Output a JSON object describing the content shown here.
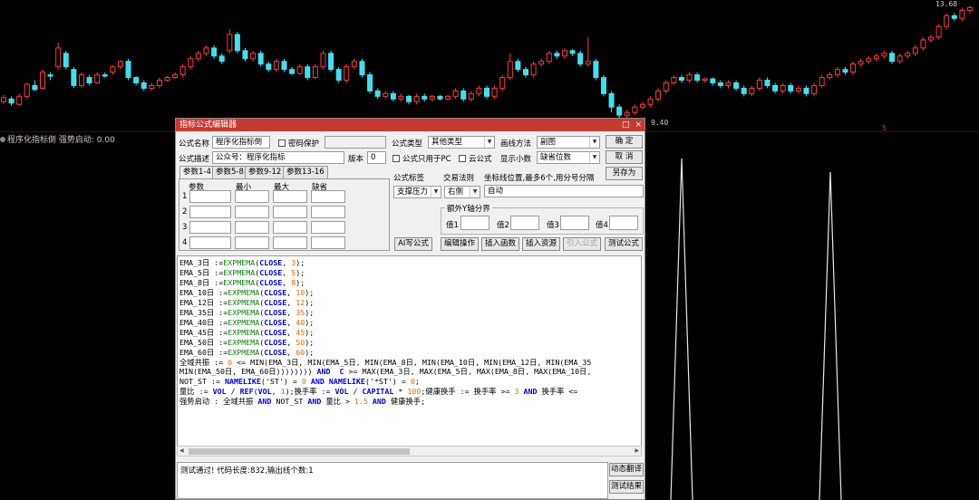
{
  "chart": {
    "price_high": "13.68",
    "price_low": "9.40",
    "candles": [
      {
        "o": 10.1,
        "c": 10.25,
        "h": 10.35,
        "l": 10.0
      },
      {
        "o": 10.2,
        "c": 10.05,
        "h": 10.3,
        "l": 9.95
      },
      {
        "o": 10.0,
        "c": 10.3,
        "h": 10.4,
        "l": 9.95
      },
      {
        "o": 10.3,
        "c": 10.75,
        "h": 10.8,
        "l": 10.2
      },
      {
        "o": 10.7,
        "c": 10.55,
        "h": 10.9,
        "l": 10.5
      },
      {
        "o": 10.6,
        "c": 11.2,
        "h": 11.3,
        "l": 10.55
      },
      {
        "o": 11.1,
        "c": 11.05,
        "h": 11.2,
        "l": 10.9
      },
      {
        "o": 11.4,
        "c": 12.1,
        "h": 12.3,
        "l": 11.3
      },
      {
        "o": 11.9,
        "c": 11.4,
        "h": 12.0,
        "l": 11.3
      },
      {
        "o": 11.3,
        "c": 10.7,
        "h": 11.4,
        "l": 10.6
      },
      {
        "o": 10.7,
        "c": 11.1,
        "h": 11.2,
        "l": 10.6
      },
      {
        "o": 11.0,
        "c": 10.8,
        "h": 11.1,
        "l": 10.7
      },
      {
        "o": 10.8,
        "c": 11.1,
        "h": 11.2,
        "l": 10.75
      },
      {
        "o": 11.1,
        "c": 11.05,
        "h": 11.2,
        "l": 11.0
      },
      {
        "o": 11.2,
        "c": 11.4,
        "h": 11.45,
        "l": 11.1
      },
      {
        "o": 11.4,
        "c": 11.6,
        "h": 11.65,
        "l": 11.3
      },
      {
        "o": 11.6,
        "c": 11.0,
        "h": 11.7,
        "l": 10.9
      },
      {
        "o": 11.0,
        "c": 10.8,
        "h": 11.05,
        "l": 10.7
      },
      {
        "o": 10.8,
        "c": 10.6,
        "h": 10.9,
        "l": 10.5
      },
      {
        "o": 10.6,
        "c": 10.7,
        "h": 10.8,
        "l": 10.5
      },
      {
        "o": 10.7,
        "c": 10.9,
        "h": 11.0,
        "l": 10.6
      },
      {
        "o": 10.9,
        "c": 11.0,
        "h": 11.05,
        "l": 10.85
      },
      {
        "o": 11.0,
        "c": 11.1,
        "h": 11.2,
        "l": 10.95
      },
      {
        "o": 11.1,
        "c": 11.4,
        "h": 11.5,
        "l": 11.0
      },
      {
        "o": 11.4,
        "c": 11.7,
        "h": 11.8,
        "l": 11.3
      },
      {
        "o": 11.7,
        "c": 11.9,
        "h": 12.0,
        "l": 11.6
      },
      {
        "o": 11.9,
        "c": 12.1,
        "h": 12.2,
        "l": 11.8
      },
      {
        "o": 12.1,
        "c": 11.8,
        "h": 12.2,
        "l": 11.7
      },
      {
        "o": 11.8,
        "c": 11.6,
        "h": 11.9,
        "l": 11.5
      },
      {
        "o": 12.0,
        "c": 12.6,
        "h": 12.8,
        "l": 11.9
      },
      {
        "o": 12.6,
        "c": 12.0,
        "h": 12.7,
        "l": 11.9
      },
      {
        "o": 12.0,
        "c": 11.7,
        "h": 12.1,
        "l": 11.6
      },
      {
        "o": 11.7,
        "c": 11.9,
        "h": 12.0,
        "l": 11.6
      },
      {
        "o": 11.9,
        "c": 11.5,
        "h": 12.0,
        "l": 11.4
      },
      {
        "o": 11.5,
        "c": 11.3,
        "h": 11.6,
        "l": 11.2
      },
      {
        "o": 11.3,
        "c": 11.6,
        "h": 11.7,
        "l": 11.2
      },
      {
        "o": 11.6,
        "c": 11.3,
        "h": 11.7,
        "l": 11.2
      },
      {
        "o": 11.3,
        "c": 11.15,
        "h": 11.4,
        "l": 11.1
      },
      {
        "o": 11.15,
        "c": 11.4,
        "h": 11.5,
        "l": 11.1
      },
      {
        "o": 11.4,
        "c": 11.0,
        "h": 11.5,
        "l": 10.9
      },
      {
        "o": 11.0,
        "c": 11.4,
        "h": 11.5,
        "l": 10.95
      },
      {
        "o": 11.4,
        "c": 11.9,
        "h": 12.0,
        "l": 11.3
      },
      {
        "o": 11.9,
        "c": 11.3,
        "h": 12.0,
        "l": 11.2
      },
      {
        "o": 11.3,
        "c": 10.9,
        "h": 11.4,
        "l": 10.8
      },
      {
        "o": 10.9,
        "c": 11.4,
        "h": 11.5,
        "l": 10.8
      },
      {
        "o": 11.4,
        "c": 11.6,
        "h": 11.7,
        "l": 11.3
      },
      {
        "o": 11.6,
        "c": 11.1,
        "h": 11.7,
        "l": 11.0
      },
      {
        "o": 11.1,
        "c": 10.5,
        "h": 11.2,
        "l": 10.4
      },
      {
        "o": 10.5,
        "c": 10.3,
        "h": 10.6,
        "l": 10.2
      },
      {
        "o": 10.3,
        "c": 10.4,
        "h": 10.5,
        "l": 10.2
      },
      {
        "o": 10.4,
        "c": 10.2,
        "h": 10.5,
        "l": 10.1
      },
      {
        "o": 10.2,
        "c": 10.3,
        "h": 10.4,
        "l": 10.1
      },
      {
        "o": 10.3,
        "c": 10.1,
        "h": 10.35,
        "l": 10.0
      },
      {
        "o": 10.1,
        "c": 10.3,
        "h": 10.4,
        "l": 10.0
      },
      {
        "o": 10.3,
        "c": 10.2,
        "h": 10.4,
        "l": 10.1
      },
      {
        "o": 10.2,
        "c": 10.3,
        "h": 10.35,
        "l": 10.1
      },
      {
        "o": 10.3,
        "c": 10.2,
        "h": 10.35,
        "l": 10.15
      },
      {
        "o": 10.2,
        "c": 10.3,
        "h": 10.35,
        "l": 10.15
      },
      {
        "o": 10.3,
        "c": 10.5,
        "h": 10.6,
        "l": 10.2
      },
      {
        "o": 10.5,
        "c": 10.2,
        "h": 10.6,
        "l": 10.1
      },
      {
        "o": 10.2,
        "c": 10.4,
        "h": 10.5,
        "l": 10.1
      },
      {
        "o": 10.4,
        "c": 10.6,
        "h": 10.7,
        "l": 10.3
      },
      {
        "o": 10.6,
        "c": 10.3,
        "h": 10.7,
        "l": 10.2
      },
      {
        "o": 10.3,
        "c": 10.6,
        "h": 10.7,
        "l": 10.2
      },
      {
        "o": 10.6,
        "c": 11.0,
        "h": 11.1,
        "l": 10.5
      },
      {
        "o": 11.0,
        "c": 11.6,
        "h": 11.9,
        "l": 10.9
      },
      {
        "o": 11.6,
        "c": 11.3,
        "h": 11.7,
        "l": 11.2
      },
      {
        "o": 11.3,
        "c": 11.1,
        "h": 11.4,
        "l": 11.0
      },
      {
        "o": 11.1,
        "c": 11.5,
        "h": 11.6,
        "l": 11.0
      },
      {
        "o": 11.5,
        "c": 11.6,
        "h": 11.7,
        "l": 11.4
      },
      {
        "o": 11.6,
        "c": 11.9,
        "h": 12.0,
        "l": 11.5
      },
      {
        "o": 11.9,
        "c": 11.8,
        "h": 12.0,
        "l": 11.7
      },
      {
        "o": 11.8,
        "c": 12.0,
        "h": 12.1,
        "l": 11.7
      },
      {
        "o": 12.0,
        "c": 11.9,
        "h": 12.05,
        "l": 11.8
      },
      {
        "o": 11.9,
        "c": 11.5,
        "h": 12.0,
        "l": 11.4
      },
      {
        "o": 11.5,
        "c": 11.6,
        "h": 12.5,
        "l": 11.4
      },
      {
        "o": 11.6,
        "c": 11.0,
        "h": 11.7,
        "l": 10.9
      },
      {
        "o": 11.0,
        "c": 10.4,
        "h": 11.1,
        "l": 10.3
      },
      {
        "o": 10.4,
        "c": 9.9,
        "h": 10.5,
        "l": 9.7
      },
      {
        "o": 9.9,
        "c": 9.6,
        "h": 10.0,
        "l": 9.4
      },
      {
        "o": 9.6,
        "c": 9.7,
        "h": 9.8,
        "l": 9.5
      },
      {
        "o": 9.7,
        "c": 9.9,
        "h": 10.0,
        "l": 9.6
      },
      {
        "o": 9.9,
        "c": 10.0,
        "h": 10.1,
        "l": 9.8
      },
      {
        "o": 10.0,
        "c": 10.2,
        "h": 10.3,
        "l": 9.9
      },
      {
        "o": 10.2,
        "c": 10.5,
        "h": 10.6,
        "l": 10.1
      },
      {
        "o": 10.5,
        "c": 10.8,
        "h": 10.9,
        "l": 10.4
      },
      {
        "o": 10.8,
        "c": 11.0,
        "h": 11.1,
        "l": 10.7
      },
      {
        "o": 11.0,
        "c": 10.9,
        "h": 11.1,
        "l": 10.8
      },
      {
        "o": 10.9,
        "c": 11.1,
        "h": 11.2,
        "l": 10.8
      },
      {
        "o": 11.1,
        "c": 10.9,
        "h": 11.2,
        "l": 10.8
      },
      {
        "o": 10.9,
        "c": 10.95,
        "h": 11.0,
        "l": 10.8
      },
      {
        "o": 10.95,
        "c": 10.8,
        "h": 11.0,
        "l": 10.7
      },
      {
        "o": 10.8,
        "c": 10.7,
        "h": 10.9,
        "l": 10.6
      },
      {
        "o": 10.7,
        "c": 10.8,
        "h": 10.9,
        "l": 10.6
      },
      {
        "o": 10.8,
        "c": 10.6,
        "h": 10.9,
        "l": 10.5
      },
      {
        "o": 10.6,
        "c": 10.4,
        "h": 10.7,
        "l": 10.3
      },
      {
        "o": 10.4,
        "c": 10.6,
        "h": 10.7,
        "l": 10.3
      },
      {
        "o": 10.6,
        "c": 10.9,
        "h": 11.0,
        "l": 10.5
      },
      {
        "o": 10.9,
        "c": 10.7,
        "h": 11.0,
        "l": 10.6
      },
      {
        "o": 10.7,
        "c": 10.5,
        "h": 10.8,
        "l": 10.4
      },
      {
        "o": 10.5,
        "c": 10.7,
        "h": 10.8,
        "l": 10.4
      },
      {
        "o": 10.7,
        "c": 10.5,
        "h": 10.8,
        "l": 10.4
      },
      {
        "o": 10.5,
        "c": 10.6,
        "h": 10.7,
        "l": 10.4
      },
      {
        "o": 10.6,
        "c": 10.4,
        "h": 10.7,
        "l": 10.3
      },
      {
        "o": 10.4,
        "c": 10.7,
        "h": 10.8,
        "l": 10.3
      },
      {
        "o": 10.7,
        "c": 11.0,
        "h": 11.1,
        "l": 10.6
      },
      {
        "o": 11.0,
        "c": 11.1,
        "h": 11.2,
        "l": 10.9
      },
      {
        "o": 11.1,
        "c": 11.3,
        "h": 11.4,
        "l": 11.0
      },
      {
        "o": 11.3,
        "c": 11.2,
        "h": 11.4,
        "l": 11.1
      },
      {
        "o": 11.2,
        "c": 11.5,
        "h": 11.6,
        "l": 11.1
      },
      {
        "o": 11.5,
        "c": 11.6,
        "h": 11.7,
        "l": 11.4
      },
      {
        "o": 11.6,
        "c": 11.7,
        "h": 11.8,
        "l": 11.5
      },
      {
        "o": 11.7,
        "c": 11.8,
        "h": 11.9,
        "l": 11.6
      },
      {
        "o": 11.8,
        "c": 11.9,
        "h": 12.0,
        "l": 11.7
      },
      {
        "o": 11.9,
        "c": 11.6,
        "h": 12.0,
        "l": 11.5
      },
      {
        "o": 11.6,
        "c": 11.8,
        "h": 11.9,
        "l": 11.5
      },
      {
        "o": 11.8,
        "c": 11.9,
        "h": 12.0,
        "l": 11.7
      },
      {
        "o": 11.9,
        "c": 12.1,
        "h": 12.2,
        "l": 11.8
      },
      {
        "o": 12.1,
        "c": 12.4,
        "h": 12.5,
        "l": 12.0
      },
      {
        "o": 12.4,
        "c": 12.5,
        "h": 12.6,
        "l": 12.3
      },
      {
        "o": 12.5,
        "c": 12.9,
        "h": 13.0,
        "l": 12.4
      },
      {
        "o": 12.9,
        "c": 13.3,
        "h": 13.4,
        "l": 12.8
      },
      {
        "o": 13.3,
        "c": 13.2,
        "h": 13.4,
        "l": 13.1
      },
      {
        "o": 13.2,
        "c": 13.5,
        "h": 13.6,
        "l": 13.1
      },
      {
        "o": 13.5,
        "c": 13.6,
        "h": 13.68,
        "l": 13.4
      }
    ]
  },
  "indicator": {
    "label": "程序化指标倒 强势启动: 0.00",
    "axis_mark": "5"
  },
  "dialog": {
    "title": "指标公式编辑器",
    "title_buttons": [
      "□",
      "×"
    ],
    "name_label": "公式名称",
    "name_value": "程序化指标倒",
    "password_label": "密码保护",
    "desc_label": "公式描述",
    "desc_value": "公众号：程序化指标",
    "version_label": "版本",
    "version_value": "0",
    "type_label": "公式类型",
    "type_value": "其他类型",
    "draw_label": "画线方法",
    "draw_value": "副图",
    "ok": "确 定",
    "cancel": "取 消",
    "saveas": "另存为",
    "pc_only": "公式只用于PC",
    "cloud": "云公式",
    "decimals_label": "显示小数",
    "decimals_value": "缺省位数",
    "tabs": [
      "参数1-4",
      "参数5-8",
      "参数9-12",
      "参数13-16"
    ],
    "param_headers": [
      "参数",
      "最小",
      "最大",
      "缺省"
    ],
    "param_rows": [
      "1",
      "2",
      "3",
      "4"
    ],
    "formula_tag_label": "公式标签",
    "formula_tag_value": "支撑压力",
    "trade_rule_label": "交易法则",
    "trade_rule_value": "右侧",
    "coord_label": "坐标线位置,最多6个,用分号分隔",
    "coord_value": "自动",
    "extra_y_label": "额外Y轴分界",
    "values_labels": [
      "值1",
      "值2",
      "值3",
      "值4"
    ],
    "buttons": [
      "AI写公式",
      "编辑操作",
      "插入函数",
      "插入资源",
      "引入公式",
      "测试公式"
    ],
    "status": "测试通过! 代码长度:832,输出线个数:1",
    "side_buttons": [
      "动态翻译",
      "测试结果"
    ]
  },
  "code": [
    [
      [
        "c",
        "EMA_3日 :="
      ],
      [
        "f",
        "EXPMEMA"
      ],
      [
        "c",
        "("
      ],
      [
        "k",
        "CLOSE"
      ],
      [
        "c",
        ", "
      ],
      [
        "n",
        "3"
      ],
      [
        "c",
        ");"
      ]
    ],
    [
      [
        "c",
        "EMA_5日 :="
      ],
      [
        "f",
        "EXPMEMA"
      ],
      [
        "c",
        "("
      ],
      [
        "k",
        "CLOSE"
      ],
      [
        "c",
        ", "
      ],
      [
        "n",
        "5"
      ],
      [
        "c",
        ");"
      ]
    ],
    [
      [
        "c",
        "EMA_8日 :="
      ],
      [
        "f",
        "EXPMEMA"
      ],
      [
        "c",
        "("
      ],
      [
        "k",
        "CLOSE"
      ],
      [
        "c",
        ", "
      ],
      [
        "n",
        "8"
      ],
      [
        "c",
        ");"
      ]
    ],
    [
      [
        "c",
        "EMA_10日 :="
      ],
      [
        "f",
        "EXPMEMA"
      ],
      [
        "c",
        "("
      ],
      [
        "k",
        "CLOSE"
      ],
      [
        "c",
        ", "
      ],
      [
        "n",
        "10"
      ],
      [
        "c",
        ");"
      ]
    ],
    [
      [
        "c",
        "EMA_12日 :="
      ],
      [
        "f",
        "EXPMEMA"
      ],
      [
        "c",
        "("
      ],
      [
        "k",
        "CLOSE"
      ],
      [
        "c",
        ", "
      ],
      [
        "n",
        "12"
      ],
      [
        "c",
        ");"
      ]
    ],
    [
      [
        "c",
        "EMA_35日 :="
      ],
      [
        "f",
        "EXPMEMA"
      ],
      [
        "c",
        "("
      ],
      [
        "k",
        "CLOSE"
      ],
      [
        "c",
        ", "
      ],
      [
        "n",
        "35"
      ],
      [
        "c",
        ");"
      ]
    ],
    [
      [
        "c",
        "EMA_40日 :="
      ],
      [
        "f",
        "EXPMEMA"
      ],
      [
        "c",
        "("
      ],
      [
        "k",
        "CLOSE"
      ],
      [
        "c",
        ", "
      ],
      [
        "n",
        "40"
      ],
      [
        "c",
        ");"
      ]
    ],
    [
      [
        "c",
        "EMA_45日 :="
      ],
      [
        "f",
        "EXPMEMA"
      ],
      [
        "c",
        "("
      ],
      [
        "k",
        "CLOSE"
      ],
      [
        "c",
        ", "
      ],
      [
        "n",
        "45"
      ],
      [
        "c",
        ");"
      ]
    ],
    [
      [
        "c",
        "EMA_50日 :="
      ],
      [
        "f",
        "EXPMEMA"
      ],
      [
        "c",
        "("
      ],
      [
        "k",
        "CLOSE"
      ],
      [
        "c",
        ", "
      ],
      [
        "n",
        "50"
      ],
      [
        "c",
        ");"
      ]
    ],
    [
      [
        "c",
        "EMA_60日 :="
      ],
      [
        "f",
        "EXPMEMA"
      ],
      [
        "c",
        "("
      ],
      [
        "k",
        "CLOSE"
      ],
      [
        "c",
        ", "
      ],
      [
        "n",
        "60"
      ],
      [
        "c",
        ");"
      ]
    ],
    [
      [
        "c",
        "全域共振 := "
      ],
      [
        "n",
        "0"
      ],
      [
        "c",
        " <= MIN(EMA_3日, MIN(EMA_5日, MIN(EMA_8日, MIN(EMA_10日, MIN(EMA_12日, MIN(EMA_35"
      ]
    ],
    [
      [
        "c",
        "MIN(EMA_50日, EMA_60日)))))))) "
      ],
      [
        "k",
        "AND"
      ],
      [
        "c",
        "  "
      ],
      [
        "k",
        "C"
      ],
      [
        "c",
        " >= MAX(EMA_3日, MAX(EMA_5日, MAX(EMA_8日, MAX(EMA_10日,"
      ]
    ],
    [
      [
        "c",
        "NOT_ST := "
      ],
      [
        "k",
        "NAMELIKE"
      ],
      [
        "c",
        "('ST') = "
      ],
      [
        "n",
        "0"
      ],
      [
        "c",
        " "
      ],
      [
        "k",
        "AND"
      ],
      [
        "c",
        " "
      ],
      [
        "k",
        "NAMELIKE"
      ],
      [
        "c",
        "('*ST') = "
      ],
      [
        "n",
        "0"
      ],
      [
        "c",
        ";"
      ]
    ],
    [
      [
        "c",
        "量比 := "
      ],
      [
        "k",
        "VOL"
      ],
      [
        "c",
        " / "
      ],
      [
        "k",
        "REF"
      ],
      [
        "c",
        "("
      ],
      [
        "k",
        "VOL"
      ],
      [
        "c",
        ", "
      ],
      [
        "n",
        "1"
      ],
      [
        "c",
        ");换手率 := "
      ],
      [
        "k",
        "VOL"
      ],
      [
        "c",
        " / "
      ],
      [
        "k",
        "CAPITAL"
      ],
      [
        "c",
        " * "
      ],
      [
        "n",
        "100"
      ],
      [
        "c",
        ";健康换手 := 换手率 >= "
      ],
      [
        "n",
        "3"
      ],
      [
        "c",
        " "
      ],
      [
        "k",
        "AND"
      ],
      [
        "c",
        " 换手率 <="
      ]
    ],
    [
      [
        "c",
        "强势启动 : 全域共振 "
      ],
      [
        "k",
        "AND"
      ],
      [
        "c",
        " NOT_ST "
      ],
      [
        "k",
        "AND"
      ],
      [
        "c",
        " 量比 > "
      ],
      [
        "n",
        "1.5"
      ],
      [
        "c",
        " "
      ],
      [
        "k",
        "AND"
      ],
      [
        "c",
        " 健康换手;"
      ]
    ]
  ]
}
